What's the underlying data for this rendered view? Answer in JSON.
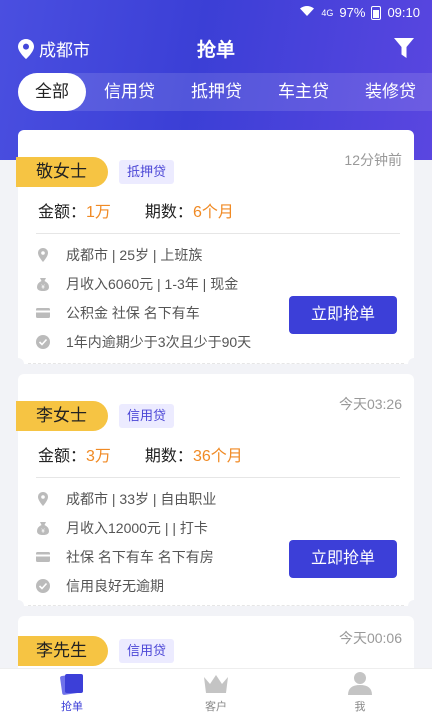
{
  "status_bar": {
    "signal": "4G",
    "battery": "97%",
    "time": "09:10"
  },
  "header": {
    "location": "成都市",
    "title": "抢单"
  },
  "tabs": [
    {
      "label": "全部",
      "active": true
    },
    {
      "label": "信用贷",
      "active": false
    },
    {
      "label": "抵押贷",
      "active": false
    },
    {
      "label": "车主贷",
      "active": false
    },
    {
      "label": "装修贷",
      "active": false
    }
  ],
  "labels": {
    "amount": "金额：",
    "period": "期数：",
    "grab": "立即抢单"
  },
  "orders": [
    {
      "name": "敬女士",
      "tag": "抵押贷",
      "time": "12分钟前",
      "amount": "1万",
      "period": "6个月",
      "info": [
        "成都市 | 25岁 | 上班族",
        "月收入6060元 | 1-3年 | 现金",
        "公积金 社保 名下有车",
        "1年内逾期少于3次且少于90天"
      ]
    },
    {
      "name": "李女士",
      "tag": "信用贷",
      "time": "今天03:26",
      "amount": "3万",
      "period": "36个月",
      "info": [
        "成都市 | 33岁 | 自由职业",
        "月收入12000元 |  | 打卡",
        "社保 名下有车 名下有房",
        "信用良好无逾期"
      ]
    },
    {
      "name": "李先生",
      "tag": "信用贷",
      "time": "今天00:06"
    }
  ],
  "bottom_nav": [
    {
      "label": "抢单",
      "active": true
    },
    {
      "label": "客户",
      "active": false
    },
    {
      "label": "我",
      "active": false
    }
  ],
  "colors": {
    "primary": "#3c3fd8",
    "accent_yellow": "#f6c443",
    "orange": "#f08a24"
  }
}
